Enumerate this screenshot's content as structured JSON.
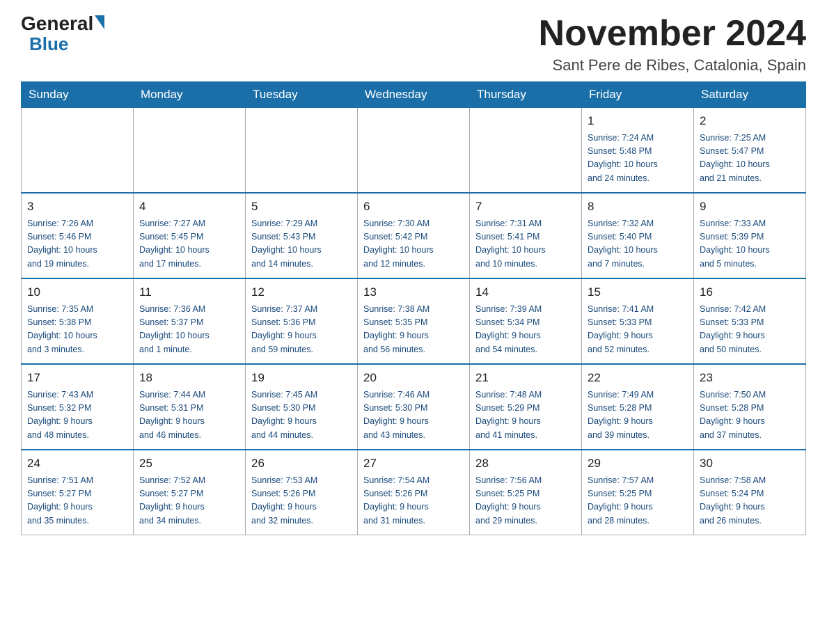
{
  "header": {
    "logo_general": "General",
    "logo_blue": "Blue",
    "month_title": "November 2024",
    "location": "Sant Pere de Ribes, Catalonia, Spain"
  },
  "weekdays": [
    "Sunday",
    "Monday",
    "Tuesday",
    "Wednesday",
    "Thursday",
    "Friday",
    "Saturday"
  ],
  "weeks": [
    [
      {
        "day": "",
        "info": ""
      },
      {
        "day": "",
        "info": ""
      },
      {
        "day": "",
        "info": ""
      },
      {
        "day": "",
        "info": ""
      },
      {
        "day": "",
        "info": ""
      },
      {
        "day": "1",
        "info": "Sunrise: 7:24 AM\nSunset: 5:48 PM\nDaylight: 10 hours\nand 24 minutes."
      },
      {
        "day": "2",
        "info": "Sunrise: 7:25 AM\nSunset: 5:47 PM\nDaylight: 10 hours\nand 21 minutes."
      }
    ],
    [
      {
        "day": "3",
        "info": "Sunrise: 7:26 AM\nSunset: 5:46 PM\nDaylight: 10 hours\nand 19 minutes."
      },
      {
        "day": "4",
        "info": "Sunrise: 7:27 AM\nSunset: 5:45 PM\nDaylight: 10 hours\nand 17 minutes."
      },
      {
        "day": "5",
        "info": "Sunrise: 7:29 AM\nSunset: 5:43 PM\nDaylight: 10 hours\nand 14 minutes."
      },
      {
        "day": "6",
        "info": "Sunrise: 7:30 AM\nSunset: 5:42 PM\nDaylight: 10 hours\nand 12 minutes."
      },
      {
        "day": "7",
        "info": "Sunrise: 7:31 AM\nSunset: 5:41 PM\nDaylight: 10 hours\nand 10 minutes."
      },
      {
        "day": "8",
        "info": "Sunrise: 7:32 AM\nSunset: 5:40 PM\nDaylight: 10 hours\nand 7 minutes."
      },
      {
        "day": "9",
        "info": "Sunrise: 7:33 AM\nSunset: 5:39 PM\nDaylight: 10 hours\nand 5 minutes."
      }
    ],
    [
      {
        "day": "10",
        "info": "Sunrise: 7:35 AM\nSunset: 5:38 PM\nDaylight: 10 hours\nand 3 minutes."
      },
      {
        "day": "11",
        "info": "Sunrise: 7:36 AM\nSunset: 5:37 PM\nDaylight: 10 hours\nand 1 minute."
      },
      {
        "day": "12",
        "info": "Sunrise: 7:37 AM\nSunset: 5:36 PM\nDaylight: 9 hours\nand 59 minutes."
      },
      {
        "day": "13",
        "info": "Sunrise: 7:38 AM\nSunset: 5:35 PM\nDaylight: 9 hours\nand 56 minutes."
      },
      {
        "day": "14",
        "info": "Sunrise: 7:39 AM\nSunset: 5:34 PM\nDaylight: 9 hours\nand 54 minutes."
      },
      {
        "day": "15",
        "info": "Sunrise: 7:41 AM\nSunset: 5:33 PM\nDaylight: 9 hours\nand 52 minutes."
      },
      {
        "day": "16",
        "info": "Sunrise: 7:42 AM\nSunset: 5:33 PM\nDaylight: 9 hours\nand 50 minutes."
      }
    ],
    [
      {
        "day": "17",
        "info": "Sunrise: 7:43 AM\nSunset: 5:32 PM\nDaylight: 9 hours\nand 48 minutes."
      },
      {
        "day": "18",
        "info": "Sunrise: 7:44 AM\nSunset: 5:31 PM\nDaylight: 9 hours\nand 46 minutes."
      },
      {
        "day": "19",
        "info": "Sunrise: 7:45 AM\nSunset: 5:30 PM\nDaylight: 9 hours\nand 44 minutes."
      },
      {
        "day": "20",
        "info": "Sunrise: 7:46 AM\nSunset: 5:30 PM\nDaylight: 9 hours\nand 43 minutes."
      },
      {
        "day": "21",
        "info": "Sunrise: 7:48 AM\nSunset: 5:29 PM\nDaylight: 9 hours\nand 41 minutes."
      },
      {
        "day": "22",
        "info": "Sunrise: 7:49 AM\nSunset: 5:28 PM\nDaylight: 9 hours\nand 39 minutes."
      },
      {
        "day": "23",
        "info": "Sunrise: 7:50 AM\nSunset: 5:28 PM\nDaylight: 9 hours\nand 37 minutes."
      }
    ],
    [
      {
        "day": "24",
        "info": "Sunrise: 7:51 AM\nSunset: 5:27 PM\nDaylight: 9 hours\nand 35 minutes."
      },
      {
        "day": "25",
        "info": "Sunrise: 7:52 AM\nSunset: 5:27 PM\nDaylight: 9 hours\nand 34 minutes."
      },
      {
        "day": "26",
        "info": "Sunrise: 7:53 AM\nSunset: 5:26 PM\nDaylight: 9 hours\nand 32 minutes."
      },
      {
        "day": "27",
        "info": "Sunrise: 7:54 AM\nSunset: 5:26 PM\nDaylight: 9 hours\nand 31 minutes."
      },
      {
        "day": "28",
        "info": "Sunrise: 7:56 AM\nSunset: 5:25 PM\nDaylight: 9 hours\nand 29 minutes."
      },
      {
        "day": "29",
        "info": "Sunrise: 7:57 AM\nSunset: 5:25 PM\nDaylight: 9 hours\nand 28 minutes."
      },
      {
        "day": "30",
        "info": "Sunrise: 7:58 AM\nSunset: 5:24 PM\nDaylight: 9 hours\nand 26 minutes."
      }
    ]
  ]
}
